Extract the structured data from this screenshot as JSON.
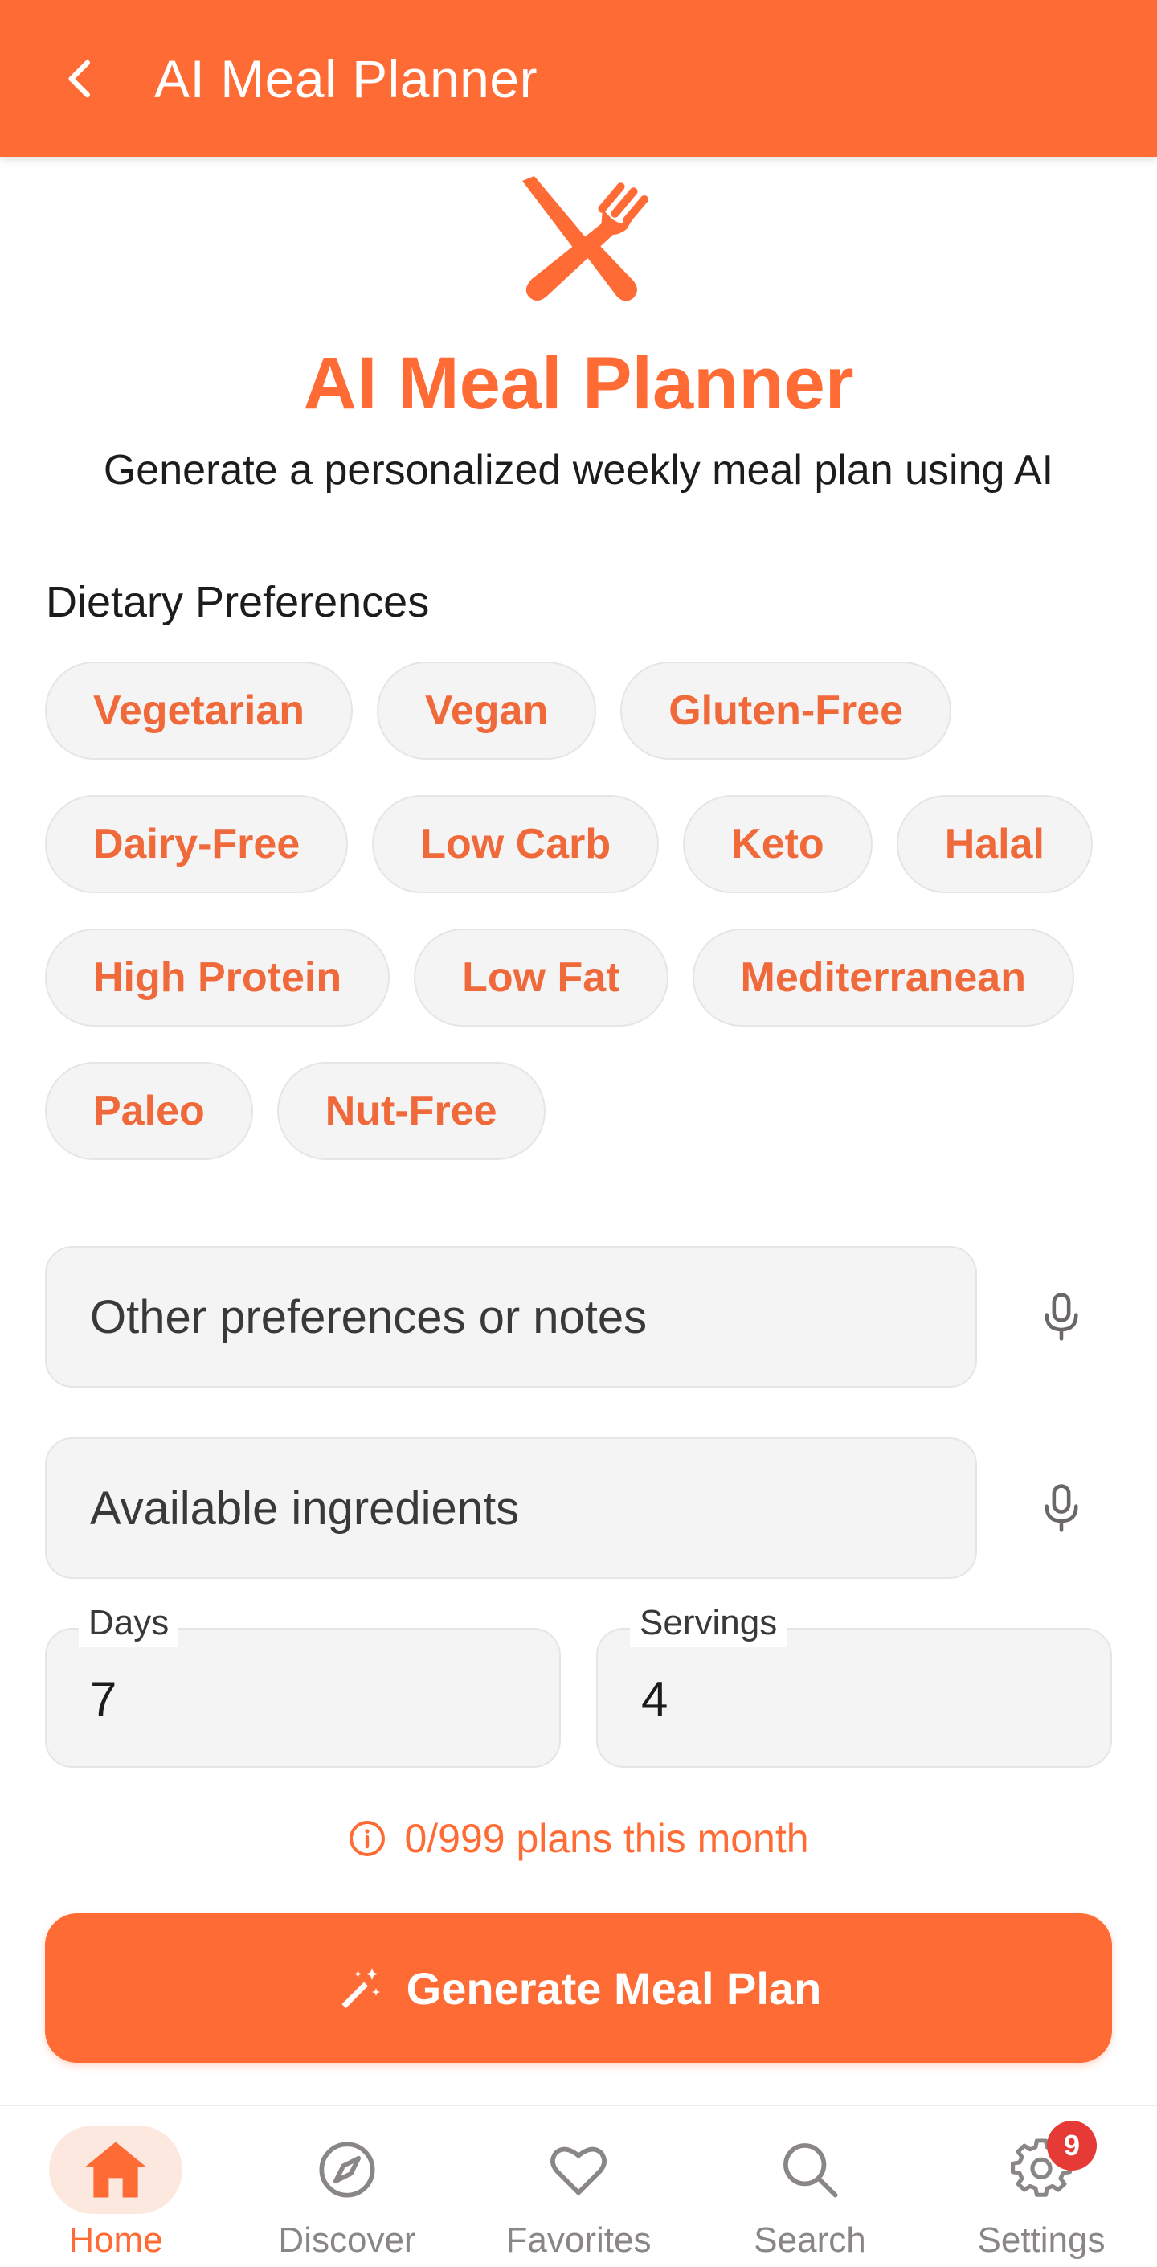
{
  "app_bar": {
    "title": "AI Meal Planner",
    "back_icon": "chevron-left-icon",
    "background_color": "#ff6b35"
  },
  "hero": {
    "icon": "fork-knife-crossed-icon",
    "title": "AI Meal Planner",
    "subtitle": "Generate a personalized weekly meal plan using AI"
  },
  "dietary": {
    "label": "Dietary Preferences",
    "rows": [
      [
        "Vegetarian",
        "Vegan",
        "Gluten-Free"
      ],
      [
        "Dairy-Free",
        "Low Carb",
        "Keto",
        "Halal"
      ],
      [
        "High Protein",
        "Low Fat",
        "Mediterranean"
      ],
      [
        "Paleo",
        "Nut-Free"
      ]
    ]
  },
  "inputs": {
    "notes_placeholder": "Other preferences or notes",
    "ingredients_placeholder": "Available ingredients",
    "mic_icon": "microphone-icon"
  },
  "days": {
    "label": "Days",
    "value": "7"
  },
  "servings": {
    "label": "Servings",
    "value": "4"
  },
  "usage": {
    "icon": "info-icon",
    "text": "0/999 plans this month"
  },
  "generate_button": {
    "icon": "magic-wand-icon",
    "label": "Generate Meal Plan"
  },
  "bottom_nav": {
    "items": [
      {
        "label": "Home",
        "icon": "home-icon",
        "active": true
      },
      {
        "label": "Discover",
        "icon": "compass-icon",
        "active": false
      },
      {
        "label": "Favorites",
        "icon": "heart-icon",
        "active": false
      },
      {
        "label": "Search",
        "icon": "search-icon",
        "active": false
      },
      {
        "label": "Settings",
        "icon": "gear-icon",
        "active": false,
        "badge": "9"
      }
    ]
  },
  "colors": {
    "accent": "#ff6b35",
    "chip_text": "#f0693a",
    "badge": "#e63a36",
    "field_bg": "#f4f4f4"
  }
}
